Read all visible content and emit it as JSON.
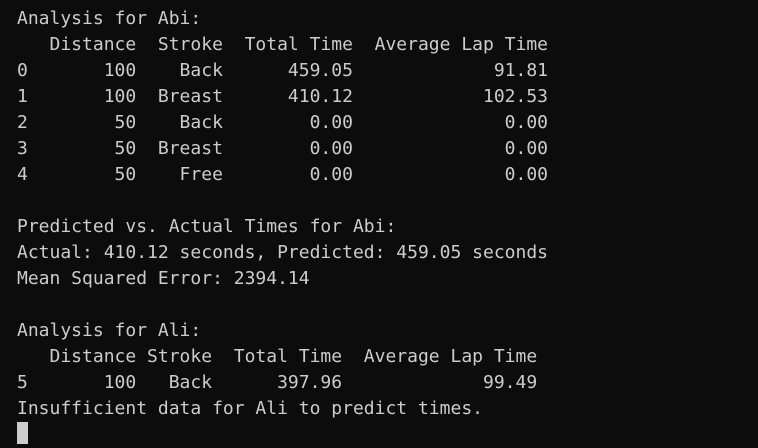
{
  "lines": [
    "Analysis for Abi:",
    "   Distance  Stroke  Total Time  Average Lap Time",
    "0       100    Back      459.05             91.81",
    "1       100  Breast      410.12            102.53",
    "2        50    Back        0.00              0.00",
    "3        50  Breast        0.00              0.00",
    "4        50    Free        0.00              0.00",
    "",
    "Predicted vs. Actual Times for Abi:",
    "Actual: 410.12 seconds, Predicted: 459.05 seconds",
    "Mean Squared Error: 2394.14",
    "",
    "Analysis for Ali:",
    "   Distance Stroke  Total Time  Average Lap Time",
    "5       100   Back      397.96             99.49",
    "Insufficient data for Ali to predict times."
  ]
}
